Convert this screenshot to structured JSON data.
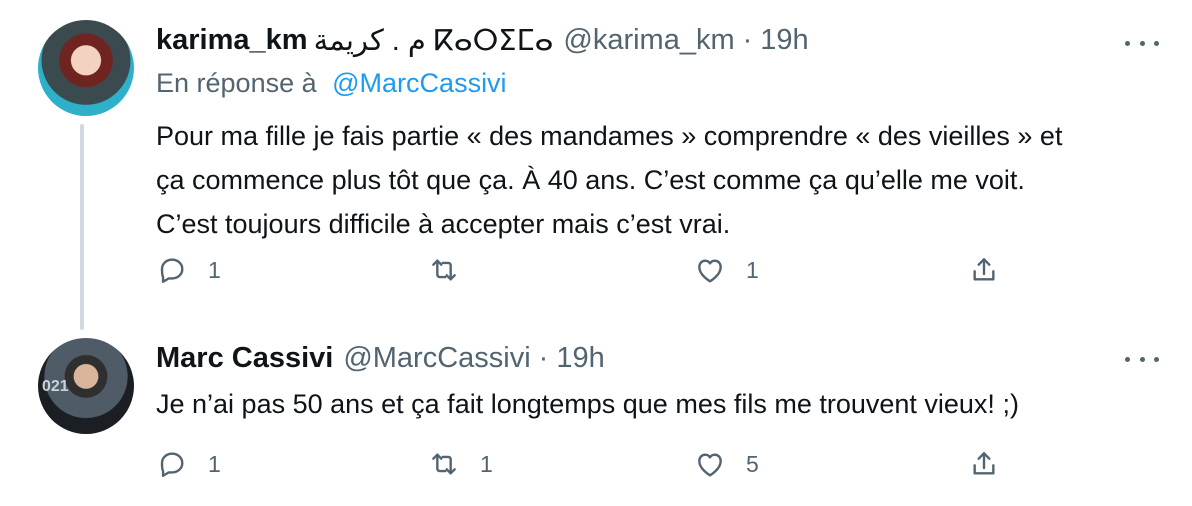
{
  "tweets": [
    {
      "author_name": "karima_km",
      "author_extra": " م . كريمة ⴽⴰⵔⵉⵎⴰ",
      "handle": "@karima_km",
      "separator": "·",
      "time": "19h",
      "reply_prefix": "En réponse à",
      "reply_mention": "@MarcCassivi",
      "text_lines": [
        "Pour ma fille je fais partie « des mandames  » comprendre « des vieilles » et",
        "ça commence plus tôt que ça. À 40 ans. C’est comme ça qu’elle me voit.",
        "C’est toujours difficile à accepter mais c’est vrai."
      ],
      "replies": "1",
      "retweets": "",
      "likes": "1"
    },
    {
      "author_name": "Marc Cassivi",
      "handle": "@MarcCassivi",
      "separator": "·",
      "time": "19h",
      "avatar_text": "021",
      "text_lines": [
        "Je n’ai pas 50 ans et ça fait longtemps que mes fils me trouvent vieux! ;)"
      ],
      "replies": "1",
      "retweets": "1",
      "likes": "5"
    }
  ],
  "icons": [
    "reply-icon",
    "retweet-icon",
    "like-icon",
    "share-icon",
    "more-icon"
  ],
  "colors": {
    "text": "#0f1419",
    "muted": "#536471",
    "link": "#1d9bf0",
    "line": "#cfd9de"
  }
}
